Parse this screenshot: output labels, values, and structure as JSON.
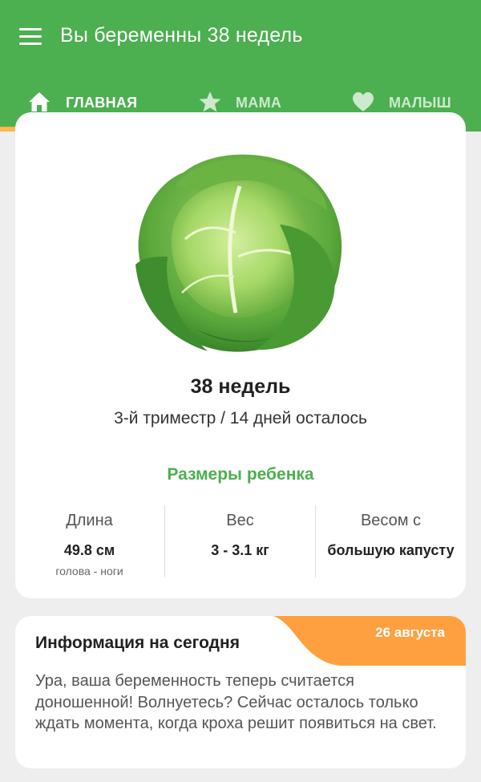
{
  "app": {
    "title": "Вы беременны 38 недель"
  },
  "tabs": [
    {
      "label": "ГЛАВНАЯ",
      "icon": "home-icon",
      "active": true
    },
    {
      "label": "МАМА",
      "icon": "star-icon",
      "active": false
    },
    {
      "label": "МАЛЫШ",
      "icon": "heart-icon",
      "active": false
    }
  ],
  "colors": {
    "primary": "#4caf50",
    "accent": "#ffb74d",
    "badge": "#ffa040",
    "background": "#eeeeee"
  },
  "main_card": {
    "image": "cabbage-illustration",
    "week_title": "38 недель",
    "trimester_line": "3-й триместр / 14 дней осталось",
    "sizes_title": "Размеры ребенка",
    "stats": [
      {
        "label": "Длина",
        "value": "49.8 см",
        "sub": "голова - ноги"
      },
      {
        "label": "Вес",
        "value": "3 - 3.1 кг",
        "sub": ""
      },
      {
        "label": "Весом с",
        "value": "большую капусту",
        "sub": ""
      }
    ]
  },
  "info_card": {
    "date": "26 августа",
    "title": "Информация на сегодня",
    "text": "Ура, ваша беременность теперь считается доношенной! Волнуетесь? Сейчас осталось только ждать момента, когда кроха решит появиться на свет."
  }
}
